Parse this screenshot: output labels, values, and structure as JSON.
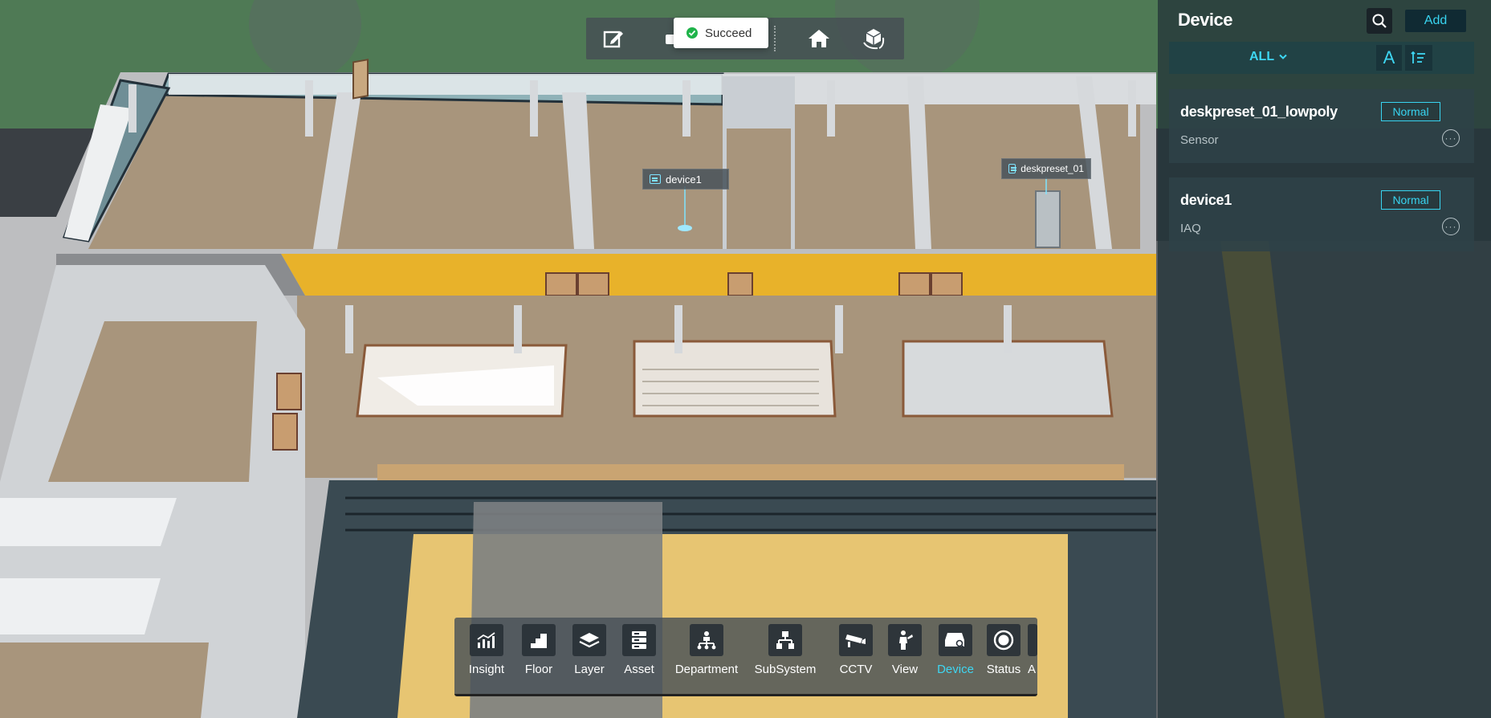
{
  "toolbar": {
    "toast_text": "Succeed"
  },
  "scene": {
    "tags": [
      {
        "label": "device1"
      },
      {
        "label": "deskpreset_01"
      }
    ]
  },
  "panel": {
    "title": "Device",
    "add_label": "Add",
    "filter_label": "ALL",
    "sort_alpha_label": "A",
    "devices": [
      {
        "name": "deskpreset_01_lowpoly",
        "type": "Sensor",
        "status": "Normal"
      },
      {
        "name": "device1",
        "type": "IAQ",
        "status": "Normal"
      }
    ]
  },
  "dock": {
    "items": [
      {
        "label": "Insight",
        "icon": "chart-icon"
      },
      {
        "label": "Floor",
        "icon": "stairs-icon"
      },
      {
        "label": "Layer",
        "icon": "layers-icon"
      },
      {
        "label": "Asset",
        "icon": "asset-icon"
      },
      {
        "label": "Department",
        "icon": "org-icon"
      },
      {
        "label": "SubSystem",
        "icon": "subsystem-icon"
      },
      {
        "label": "CCTV",
        "icon": "camera-icon"
      },
      {
        "label": "View",
        "icon": "person-icon"
      },
      {
        "label": "Device",
        "icon": "device-icon"
      },
      {
        "label": "Status",
        "icon": "status-icon"
      },
      {
        "label": "A",
        "icon": "more-icon"
      }
    ],
    "active": "Device"
  },
  "colors": {
    "accent": "#38d4f0",
    "corridor_yellow": "#e8b22a",
    "floor_tan": "#a8957c",
    "atrium_sand": "#e7c572",
    "success": "#1fb34a"
  }
}
